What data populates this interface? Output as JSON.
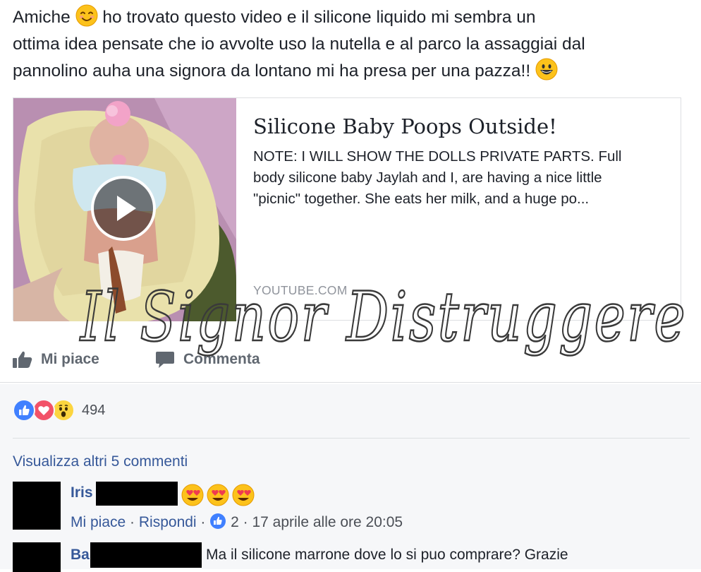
{
  "post": {
    "text_line1_a": "Amiche",
    "text_line1_b": "ho trovato questo video e il silicone liquido mi sembra un",
    "text_line2": "ottima idea pensate che io avvolte uso la nutella e al parco la assaggiai dal",
    "text_line3": "pannolino auha una signora da lontano mi ha presa per una pazza!!"
  },
  "link_card": {
    "title": "Silicone Baby Poops Outside!",
    "description_line1": "NOTE: I WILL SHOW THE DOLLS PRIVATE PARTS. Full",
    "description_line2": "body silicone baby Jaylah and I, are having a nice little",
    "description_line3": "\"picnic\" together. She eats her milk, and a huge po...",
    "domain": "YOUTUBE.COM"
  },
  "actions": {
    "like_label": "Mi piace",
    "comment_label": "Commenta"
  },
  "reactions": {
    "count": "494",
    "icons": [
      "like-icon",
      "love-icon",
      "wow-icon"
    ]
  },
  "comments_section": {
    "view_more": "Visualizza altri 5 commenti",
    "comments": [
      {
        "name": "Iris",
        "meta_like": "Mi piace",
        "meta_sep1": " · ",
        "meta_reply": "Rispondi",
        "meta_sep2": " · ",
        "like_count": "2",
        "meta_time": " · 17 aprile alle ore 20:05"
      },
      {
        "name": "Ba",
        "text": "Ma il silicone marrone dove lo si puo comprare? Grazie"
      }
    ]
  },
  "watermark": {
    "text": "Il Signor Distruggere"
  },
  "colors": {
    "link_blue": "#365899",
    "text_dark": "#1d2129",
    "meta_gray": "#90949c",
    "like_blue": "#4080ff",
    "love_red": "#f25268",
    "wow_yellow": "#fcd53f"
  }
}
